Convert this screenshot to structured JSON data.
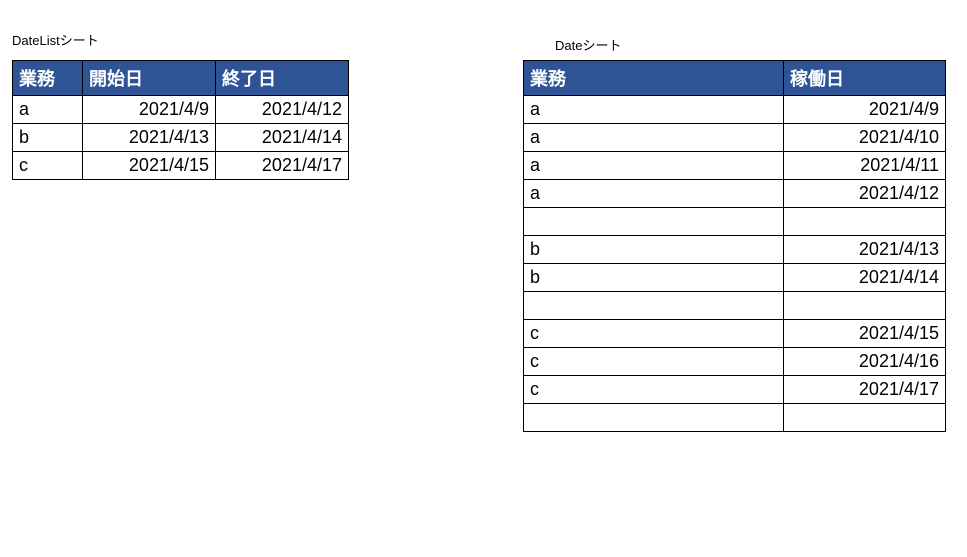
{
  "left": {
    "label": "DateListシート",
    "headers": {
      "task": "業務",
      "start": "開始日",
      "end": "終了日"
    },
    "rows": [
      {
        "task": "a",
        "start": "2021/4/9",
        "end": "2021/4/12"
      },
      {
        "task": "b",
        "start": "2021/4/13",
        "end": "2021/4/14"
      },
      {
        "task": "c",
        "start": "2021/4/15",
        "end": "2021/4/17"
      }
    ]
  },
  "right": {
    "label": "Dateシート",
    "headers": {
      "task": "業務",
      "date": "稼働日"
    },
    "rows": [
      {
        "task": "a",
        "date": "2021/4/9"
      },
      {
        "task": "a",
        "date": "2021/4/10"
      },
      {
        "task": "a",
        "date": "2021/4/11"
      },
      {
        "task": "a",
        "date": "2021/4/12"
      },
      {
        "task": "",
        "date": ""
      },
      {
        "task": "b",
        "date": "2021/4/13"
      },
      {
        "task": "b",
        "date": "2021/4/14"
      },
      {
        "task": "",
        "date": ""
      },
      {
        "task": "c",
        "date": "2021/4/15"
      },
      {
        "task": "c",
        "date": "2021/4/16"
      },
      {
        "task": "c",
        "date": "2021/4/17"
      },
      {
        "task": "",
        "date": ""
      }
    ]
  }
}
